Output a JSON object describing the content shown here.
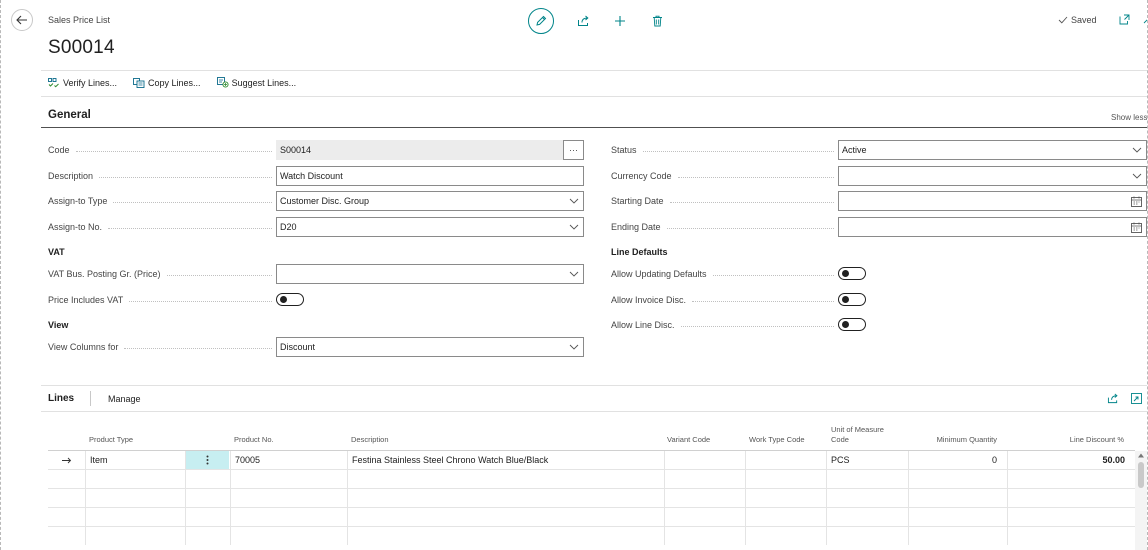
{
  "header": {
    "breadcrumb": "Sales Price List",
    "title": "S00014",
    "saved_label": "Saved"
  },
  "actions": [
    {
      "label": "Verify Lines...",
      "icon": "verify-lines-icon"
    },
    {
      "label": "Copy Lines...",
      "icon": "copy-lines-icon"
    },
    {
      "label": "Suggest Lines...",
      "icon": "suggest-lines-icon"
    }
  ],
  "general": {
    "title": "General",
    "show_less": "Show less",
    "code": {
      "label": "Code",
      "value": "S00014"
    },
    "description": {
      "label": "Description",
      "value": "Watch Discount"
    },
    "assign_to_type": {
      "label": "Assign-to Type",
      "value": "Customer Disc. Group"
    },
    "assign_to_no": {
      "label": "Assign-to No.",
      "value": "D20"
    },
    "vat_group": "VAT",
    "vat_bus_posting": {
      "label": "VAT Bus. Posting Gr. (Price)",
      "value": ""
    },
    "price_includes_vat": {
      "label": "Price Includes VAT",
      "on": false
    },
    "view_group": "View",
    "view_columns_for": {
      "label": "View Columns for",
      "value": "Discount"
    },
    "status": {
      "label": "Status",
      "value": "Active"
    },
    "currency_code": {
      "label": "Currency Code",
      "value": ""
    },
    "starting_date": {
      "label": "Starting Date",
      "value": ""
    },
    "ending_date": {
      "label": "Ending Date",
      "value": ""
    },
    "line_defaults_group": "Line Defaults",
    "allow_updating_defaults": {
      "label": "Allow Updating Defaults",
      "on": false
    },
    "allow_invoice_disc": {
      "label": "Allow Invoice Disc.",
      "on": false
    },
    "allow_line_disc": {
      "label": "Allow Line Disc.",
      "on": false
    }
  },
  "lines": {
    "title": "Lines",
    "manage": "Manage",
    "columns": {
      "product_type": "Product Type",
      "product_no": "Product No.",
      "description": "Description",
      "variant_code": "Variant Code",
      "work_type_code": "Work Type Code",
      "unit_of_measure_code": "Unit of Measure Code",
      "minimum_quantity": "Minimum Quantity",
      "line_discount": "Line Discount %"
    },
    "rows": [
      {
        "product_type": "Item",
        "product_no": "70005",
        "description": "Festina Stainless Steel Chrono Watch Blue/Black",
        "variant_code": "",
        "work_type_code": "",
        "unit_of_measure_code": "PCS",
        "minimum_quantity": "0",
        "line_discount": "50.00"
      }
    ]
  },
  "colors": {
    "accent": "#008489",
    "row_menu_bg": "#c7eef1"
  }
}
